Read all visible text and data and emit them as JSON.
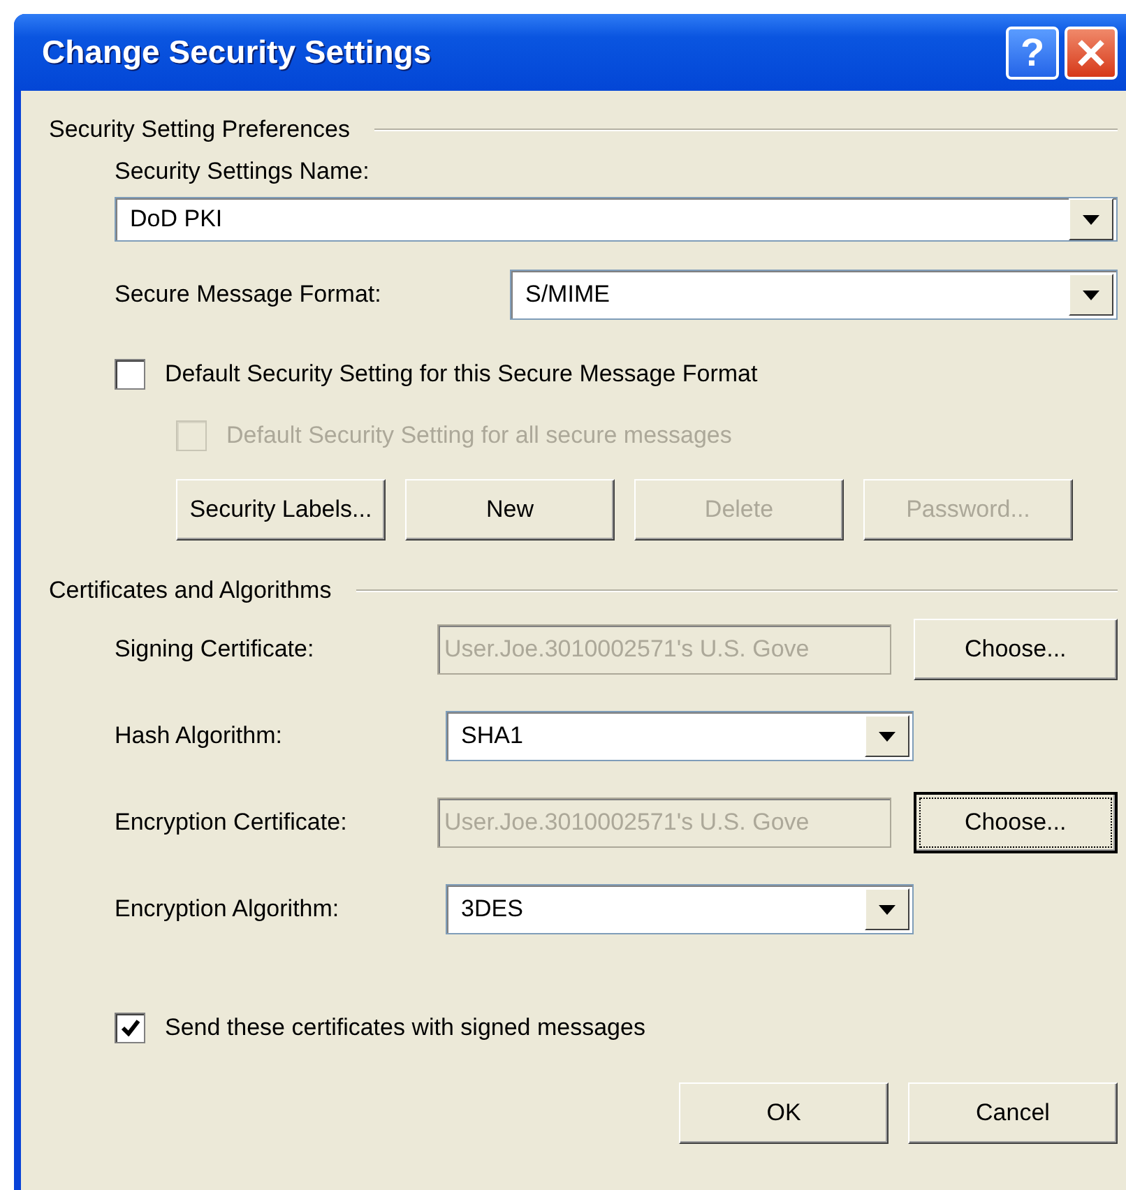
{
  "window": {
    "title": "Change Security Settings",
    "help_label": "?"
  },
  "preferences": {
    "heading": "Security Setting Preferences",
    "name_label": "Security Settings Name:",
    "name_value": "DoD PKI",
    "format_label": "Secure Message Format:",
    "format_value": "S/MIME",
    "checkboxes": [
      {
        "label": "Default Security Setting for this Secure Message Format",
        "checked": false,
        "disabled": false
      },
      {
        "label": "Default Security Setting for all secure messages",
        "checked": false,
        "disabled": true
      }
    ],
    "buttons": [
      {
        "label": "Security Labels...",
        "disabled": false
      },
      {
        "label": "New",
        "disabled": false
      },
      {
        "label": "Delete",
        "disabled": true
      },
      {
        "label": "Password...",
        "disabled": true
      }
    ]
  },
  "certificates": {
    "heading": "Certificates and Algorithms",
    "rows": [
      {
        "kind": "certificate",
        "label": "Signing Certificate:",
        "value": "User.Joe.3010002571's U.S. Gove",
        "disabled": true,
        "button": "Choose...",
        "focused": false
      },
      {
        "kind": "combo",
        "label": "Hash Algorithm:",
        "value": "SHA1"
      },
      {
        "kind": "certificate",
        "label": "Encryption Certificate:",
        "value": "User.Joe.3010002571's U.S. Gove",
        "disabled": true,
        "button": "Choose...",
        "focused": true
      },
      {
        "kind": "combo",
        "label": "Encryption Algorithm:",
        "value": "3DES"
      }
    ],
    "send_checkbox": {
      "label": "Send these certificates with signed messages",
      "checked": true
    }
  },
  "footer_buttons": [
    {
      "label": "OK"
    },
    {
      "label": "Cancel"
    }
  ]
}
